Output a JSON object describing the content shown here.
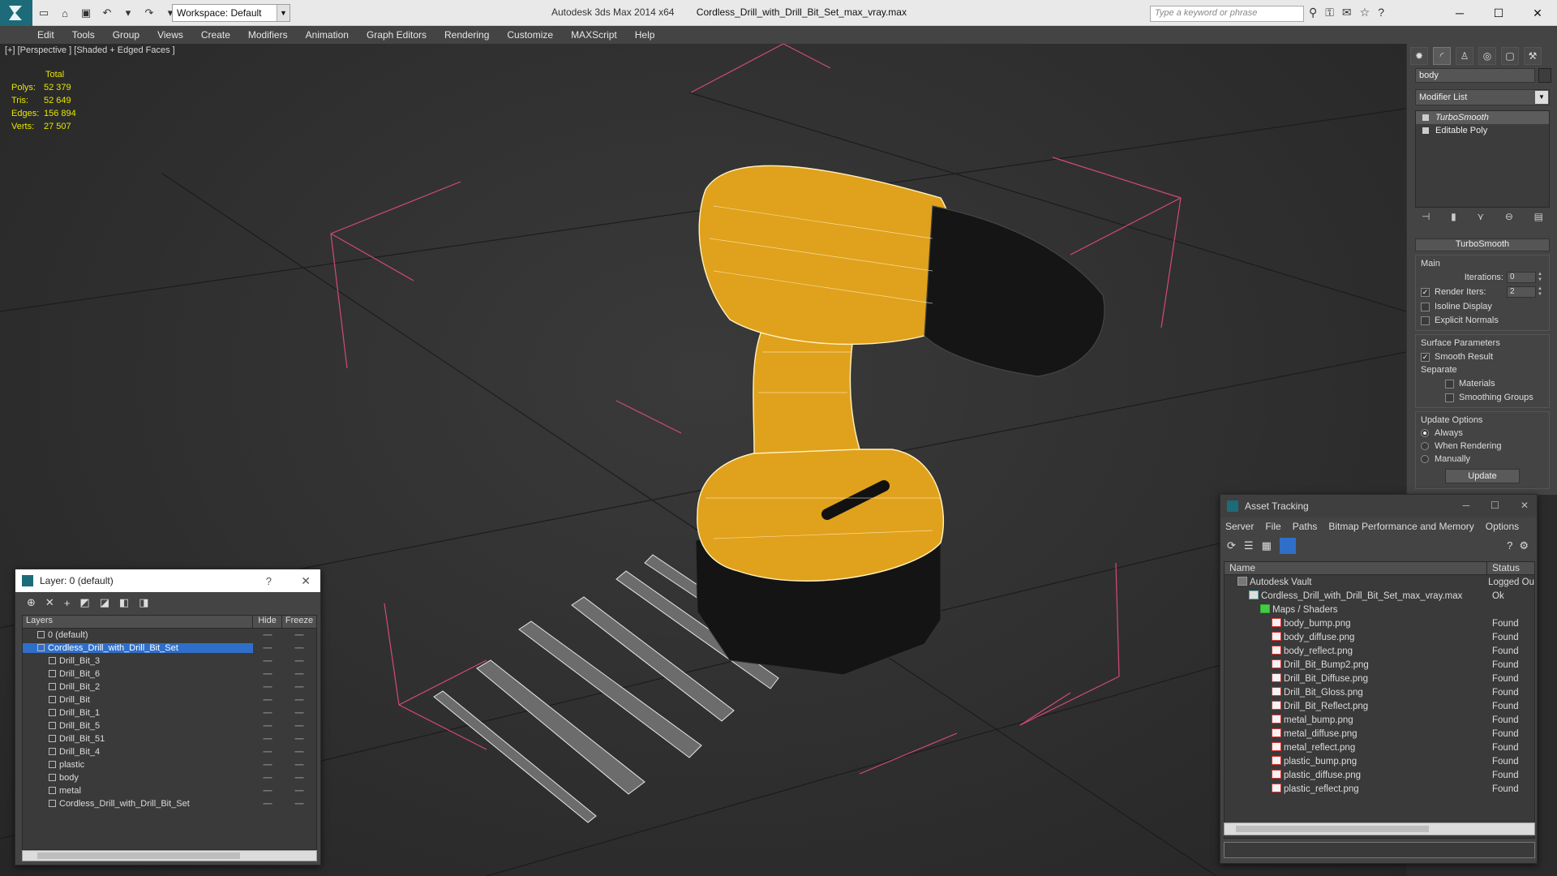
{
  "titlebar": {
    "workspace": "Workspace: Default",
    "app": "Autodesk 3ds Max  2014 x64",
    "file": "Cordless_Drill_with_Drill_Bit_Set_max_vray.max",
    "search_placeholder": "Type a keyword or phrase"
  },
  "menu": [
    "Edit",
    "Tools",
    "Group",
    "Views",
    "Create",
    "Modifiers",
    "Animation",
    "Graph Editors",
    "Rendering",
    "Customize",
    "MAXScript",
    "Help"
  ],
  "viewport": {
    "label": "[+] [Perspective ] [Shaded + Edged Faces ]",
    "stats_header": "Total",
    "stats": [
      {
        "k": "Polys:",
        "v": "52 379"
      },
      {
        "k": "Tris:",
        "v": "52 649"
      },
      {
        "k": "Edges:",
        "v": "156 894"
      },
      {
        "k": "Verts:",
        "v": "27 507"
      }
    ],
    "colors": {
      "drill": "#e0a11c",
      "wire": "#ffffff",
      "bbox": "#d24a78"
    }
  },
  "cmdpanel": {
    "object_name": "body",
    "modifier_list": "Modifier List",
    "stack": [
      "TurboSmooth",
      "Editable Poly"
    ],
    "rollout_title": "TurboSmooth",
    "main_label": "Main",
    "iterations_label": "Iterations:",
    "iterations": "0",
    "render_iters_label": "Render Iters:",
    "render_iters": "2",
    "isoline": "Isoline Display",
    "explicit_normals": "Explicit Normals",
    "surface_label": "Surface Parameters",
    "smooth_result": "Smooth Result",
    "separate": "Separate",
    "materials": "Materials",
    "smoothing_groups": "Smoothing Groups",
    "update_label": "Update Options",
    "always": "Always",
    "when_rendering": "When Rendering",
    "manually": "Manually",
    "update_btn": "Update"
  },
  "layers": {
    "title": "Layer: 0 (default)",
    "col_layers": "Layers",
    "col_hide": "Hide",
    "col_freeze": "Freeze",
    "rows": [
      "0 (default)",
      "Cordless_Drill_with_Drill_Bit_Set",
      "Drill_Bit_3",
      "Drill_Bit_6",
      "Drill_Bit_2",
      "Drill_Bit",
      "Drill_Bit_1",
      "Drill_Bit_5",
      "Drill_Bit_51",
      "Drill_Bit_4",
      "plastic",
      "body",
      "metal",
      "Cordless_Drill_with_Drill_Bit_Set"
    ]
  },
  "assets": {
    "title": "Asset Tracking",
    "menu": [
      "Server",
      "File",
      "Paths",
      "Bitmap Performance and Memory",
      "Options"
    ],
    "col_name": "Name",
    "col_status": "Status",
    "rows": [
      {
        "name": "Autodesk Vault",
        "status": "Logged Ou"
      },
      {
        "name": "Cordless_Drill_with_Drill_Bit_Set_max_vray.max",
        "status": "Ok"
      },
      {
        "name": "Maps / Shaders",
        "status": ""
      },
      {
        "name": "body_bump.png",
        "status": "Found"
      },
      {
        "name": "body_diffuse.png",
        "status": "Found"
      },
      {
        "name": "body_reflect.png",
        "status": "Found"
      },
      {
        "name": "Drill_Bit_Bump2.png",
        "status": "Found"
      },
      {
        "name": "Drill_Bit_Diffuse.png",
        "status": "Found"
      },
      {
        "name": "Drill_Bit_Gloss.png",
        "status": "Found"
      },
      {
        "name": "Drill_Bit_Reflect.png",
        "status": "Found"
      },
      {
        "name": "metal_bump.png",
        "status": "Found"
      },
      {
        "name": "metal_diffuse.png",
        "status": "Found"
      },
      {
        "name": "metal_reflect.png",
        "status": "Found"
      },
      {
        "name": "plastic_bump.png",
        "status": "Found"
      },
      {
        "name": "plastic_diffuse.png",
        "status": "Found"
      },
      {
        "name": "plastic_reflect.png",
        "status": "Found"
      }
    ]
  }
}
